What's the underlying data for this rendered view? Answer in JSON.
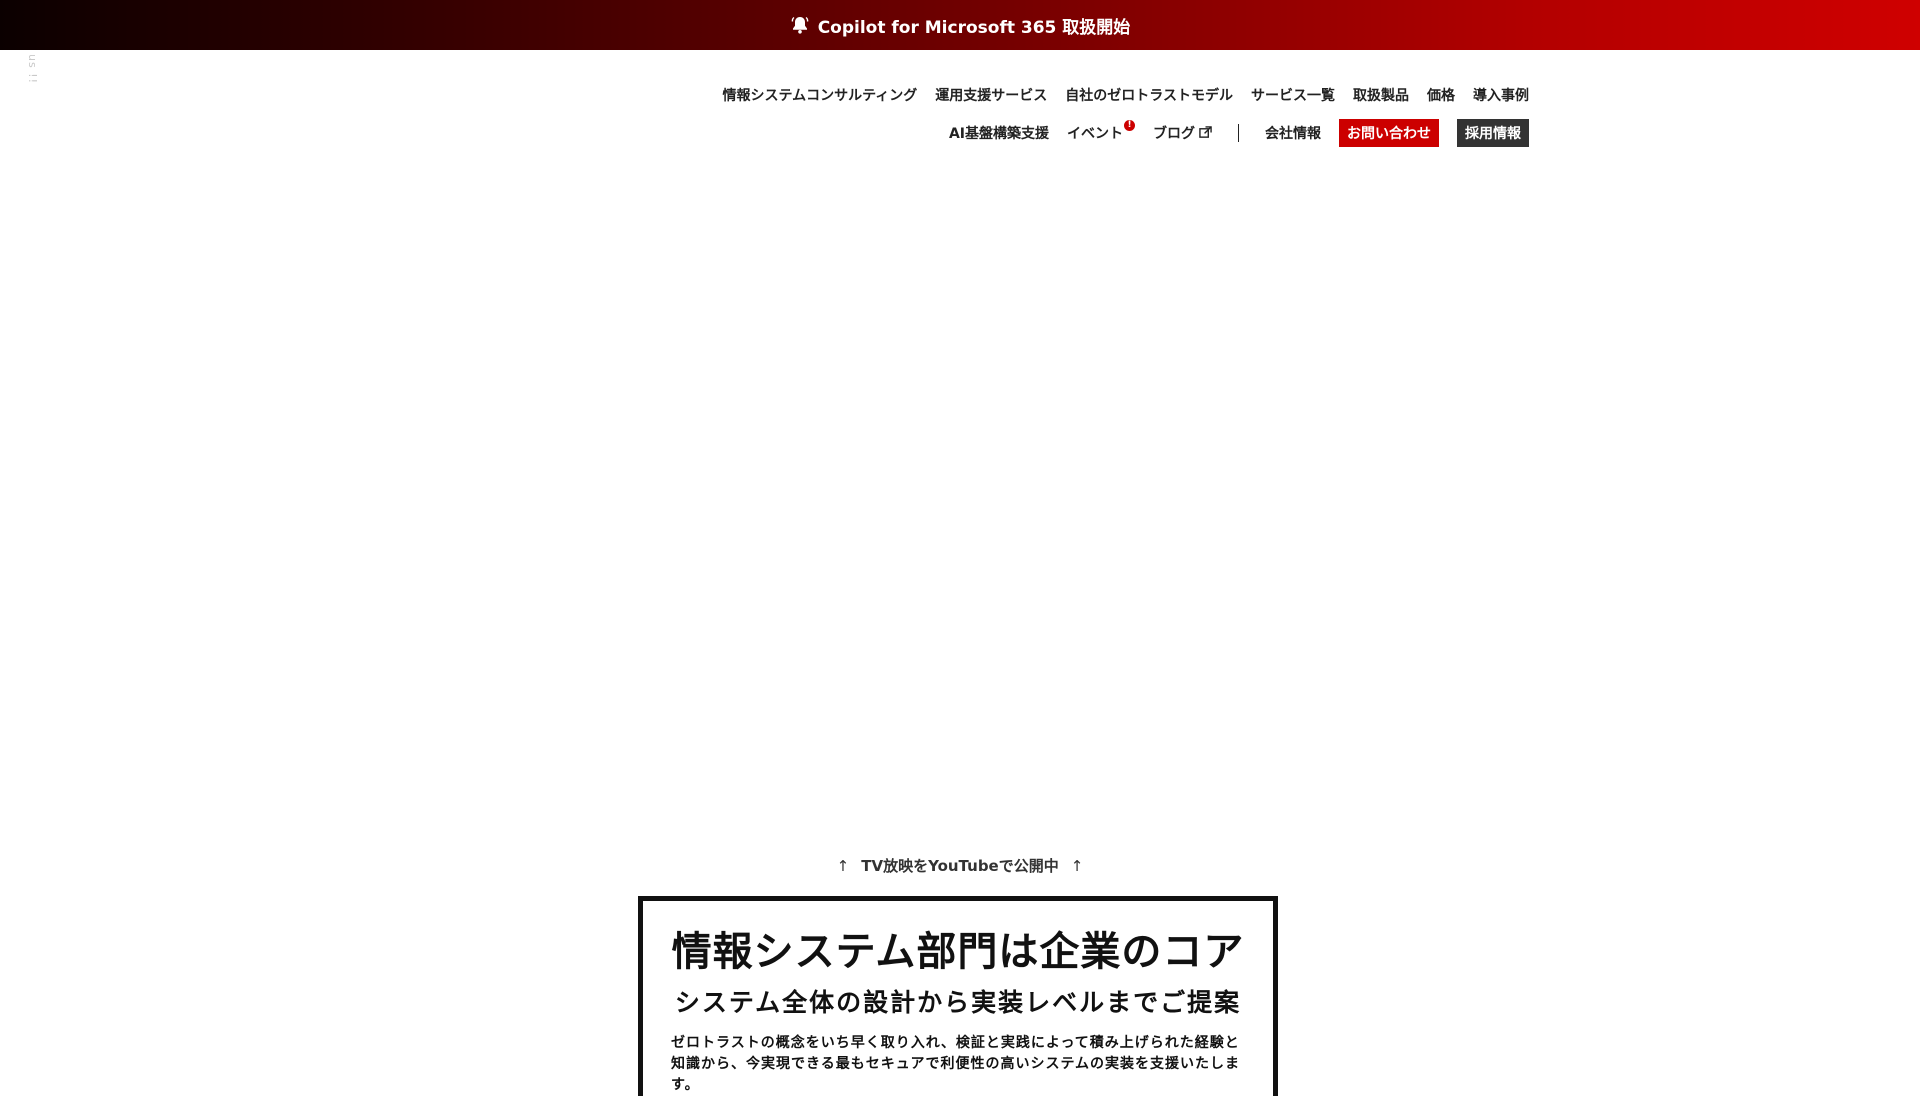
{
  "announcement": {
    "icon": "bell-icon",
    "text": "Copilot for Microsoft 365 取扱開始"
  },
  "side_text": "us !!",
  "nav": {
    "row1": [
      "情報システムコンサルティング",
      "運用支援サービス",
      "自社のゼロトラストモデル",
      "サービス一覧",
      "取扱製品",
      "価格",
      "導入事例"
    ],
    "row2": {
      "ai": "AI基盤構築支援",
      "event": "イベント",
      "event_badge": "!",
      "blog": "ブログ",
      "company": "会社情報",
      "contact": "お問い合わせ",
      "recruit": "採用情報"
    }
  },
  "tv_note": "TV放映をYouTubeで公開中",
  "core": {
    "title": "情報システム部門は企業のコア",
    "subtitle": "システム全体の設計から実装レベルまでご提案",
    "body": "ゼロトラストの概念をいち早く取り入れ、検証と実践によって積み上げられた経験と知識から、今実現できる最もセキュアで利便性の高いシステムの実装を支援いたします。"
  },
  "colors": {
    "banner_start": "#0b0000",
    "banner_end": "#cf0000",
    "contact_button": "#cc0000",
    "recruit_button": "#333333"
  }
}
